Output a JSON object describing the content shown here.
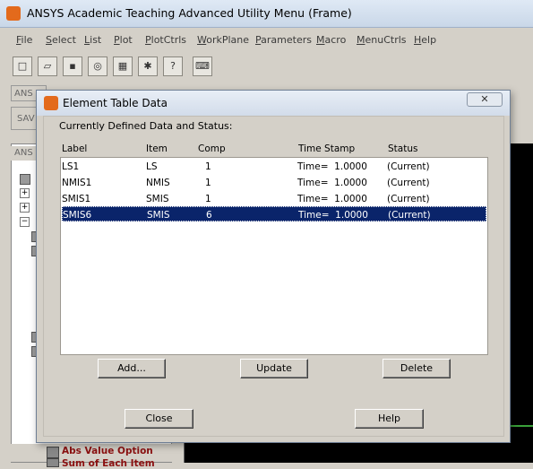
{
  "app": {
    "title": "ANSYS Academic Teaching Advanced Utility Menu (Frame)",
    "menu": [
      "File",
      "Select",
      "List",
      "Plot",
      "PlotCtrls",
      "WorkPlane",
      "Parameters",
      "Macro",
      "MenuCtrls",
      "Help"
    ],
    "toolbox_label": "ANS",
    "save_label": "SAV",
    "main_menu_label": "ANS",
    "bottom_item": "Abs Value Option",
    "bottom_item2": "Sum of Each Item"
  },
  "dialog": {
    "title": "Element Table Data",
    "close_glyph": "✕",
    "subheading": "Currently Defined Data and Status:",
    "columns": [
      "Label",
      "Item",
      "Comp",
      "Time Stamp",
      "Status"
    ],
    "rows": [
      {
        "label": "LS1",
        "item": "LS",
        "comp": "1",
        "time": "Time=  1.0000",
        "status": "(Current)"
      },
      {
        "label": "NMIS1",
        "item": "NMIS",
        "comp": "1",
        "time": "Time=  1.0000",
        "status": "(Current)"
      },
      {
        "label": "SMIS1",
        "item": "SMIS",
        "comp": "1",
        "time": "Time=  1.0000",
        "status": "(Current)"
      },
      {
        "label": "SMIS6",
        "item": "SMIS",
        "comp": "6",
        "time": "Time=  1.0000",
        "status": "(Current)"
      }
    ],
    "selected_row": 3,
    "buttons": {
      "add": "Add...",
      "update": "Update",
      "delete": "Delete",
      "close": "Close",
      "help": "Help"
    }
  },
  "colors": {
    "selection": "#0a246a",
    "accent_icon": "#e36a1c"
  }
}
